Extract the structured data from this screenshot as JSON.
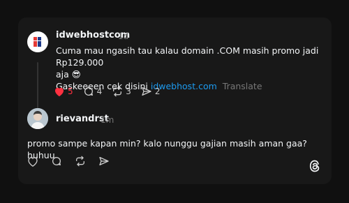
{
  "post": {
    "username": "idwebhostcom",
    "time": "1d",
    "line1": "Cuma mau ngasih tau kalau domain .COM masih promo jadi Rp129.000",
    "line2": "aja 😎",
    "line3_prefix": "Gaskeeeen cek disini",
    "link": "idwebhost.com",
    "translate": "Translate",
    "likes": "5",
    "replies": "4",
    "reposts": "3",
    "shares": "2",
    "liked": true,
    "like_color": "#ff3040"
  },
  "reply": {
    "username": "rievandrst",
    "time": "1m",
    "text": "promo sampe kapan min? kalo nunggu gajian masih aman gaa? huhuu"
  },
  "icons": {
    "like": "heart-icon",
    "reply": "comment-icon",
    "repost": "repost-icon",
    "share": "send-icon",
    "brand": "threads-logo-icon"
  }
}
